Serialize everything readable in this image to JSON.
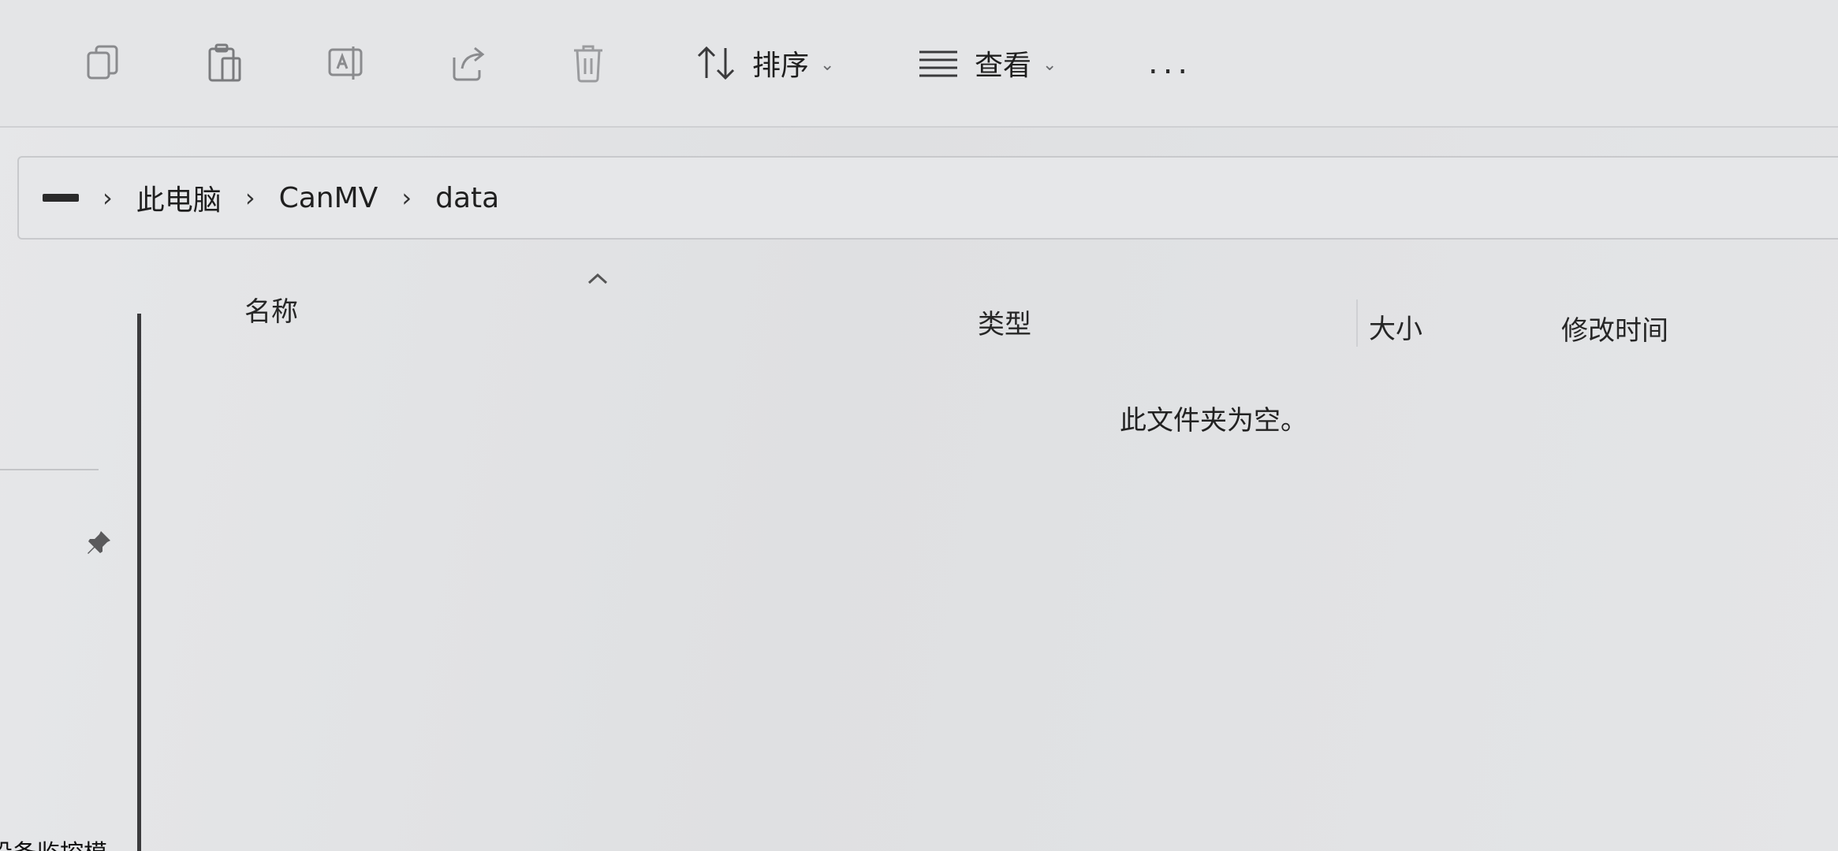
{
  "toolbar": {
    "icons": [
      "copy-icon",
      "paste-icon",
      "rename-icon",
      "share-icon",
      "delete-icon"
    ],
    "sort_label": "排序",
    "view_label": "查看",
    "more_label": "..."
  },
  "breadcrumb": {
    "items": [
      "此电脑",
      "CanMV",
      "data"
    ]
  },
  "columns": {
    "name": "名称",
    "type": "类型",
    "size": "大小",
    "modified": "修改时间"
  },
  "content": {
    "empty_message": "此文件夹为空。"
  },
  "nav": {
    "partial_label": "设备监控模"
  }
}
